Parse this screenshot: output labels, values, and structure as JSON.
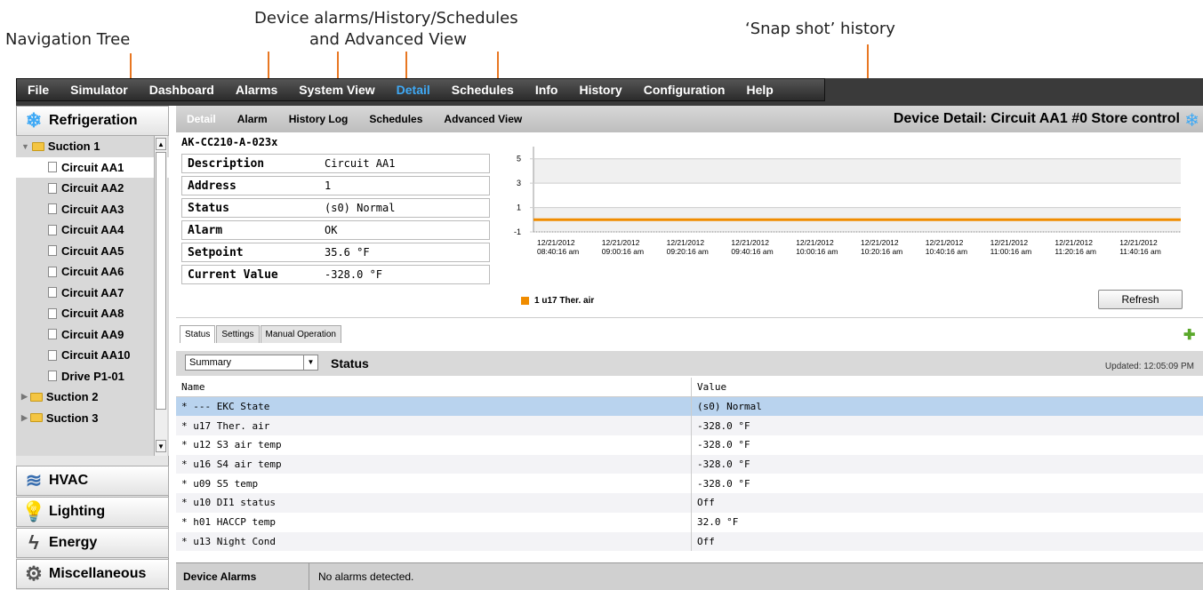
{
  "annotations": {
    "nav_tree": "Navigation Tree",
    "device_views_line1": "Device alarms/History/Schedules",
    "device_views_line2": "and Advanced View",
    "snapshot": "‘Snap shot’ history"
  },
  "menubar": {
    "items": [
      "File",
      "Simulator",
      "Dashboard",
      "Alarms",
      "System View",
      "Detail",
      "Schedules",
      "Info",
      "History",
      "Configuration",
      "Help"
    ],
    "active": "Detail"
  },
  "nav": {
    "categories": {
      "refrigeration": "Refrigeration",
      "hvac": "HVAC",
      "lighting": "Lighting",
      "energy": "Energy",
      "misc": "Miscellaneous"
    },
    "tree": [
      {
        "type": "folder",
        "label": "Suction 1",
        "open": true
      },
      {
        "type": "leaf",
        "label": "Circuit AA1",
        "selected": true
      },
      {
        "type": "leaf",
        "label": "Circuit AA2"
      },
      {
        "type": "leaf",
        "label": "Circuit AA3"
      },
      {
        "type": "leaf",
        "label": "Circuit AA4"
      },
      {
        "type": "leaf",
        "label": "Circuit AA5"
      },
      {
        "type": "leaf",
        "label": "Circuit AA6"
      },
      {
        "type": "leaf",
        "label": "Circuit AA7"
      },
      {
        "type": "leaf",
        "label": "Circuit AA8"
      },
      {
        "type": "leaf",
        "label": "Circuit AA9"
      },
      {
        "type": "leaf",
        "label": "Circuit AA10"
      },
      {
        "type": "leaf",
        "label": "Drive P1-01"
      },
      {
        "type": "folder",
        "label": "Suction 2",
        "open": false
      },
      {
        "type": "folder",
        "label": "Suction 3",
        "open": false
      }
    ]
  },
  "detail": {
    "tabs": [
      "Detail",
      "Alarm",
      "History Log",
      "Schedules",
      "Advanced View"
    ],
    "active_tab": "Detail",
    "title": "Device Detail: Circuit AA1  #0 Store control",
    "model": "AK-CC210-A-023x",
    "properties": [
      {
        "key": "Description",
        "value": "Circuit AA1"
      },
      {
        "key": "Address",
        "value": "1"
      },
      {
        "key": "Status",
        "value": "(s0) Normal"
      },
      {
        "key": "Alarm",
        "value": "OK"
      },
      {
        "key": "Setpoint",
        "value": "35.6 °F"
      },
      {
        "key": "Current Value",
        "value": "-328.0 °F"
      }
    ],
    "refresh_label": "Refresh",
    "legend": "1 u17 Ther. air"
  },
  "chart_data": {
    "type": "line",
    "yticks": [
      5,
      3,
      1,
      -1
    ],
    "ylim": [
      -1,
      6
    ],
    "x": [
      "12/21/2012 08:40:16 am",
      "12/21/2012 09:00:16 am",
      "12/21/2012 09:20:16 am",
      "12/21/2012 09:40:16 am",
      "12/21/2012 10:00:16 am",
      "12/21/2012 10:20:16 am",
      "12/21/2012 10:40:16 am",
      "12/21/2012 11:00:16 am",
      "12/21/2012 11:20:16 am",
      "12/21/2012 11:40:16 am"
    ],
    "series": [
      {
        "name": "1 u17 Ther. air",
        "values": [
          0,
          0,
          0,
          0,
          0,
          0,
          0,
          0,
          0,
          0,
          0
        ],
        "color": "#f08c00"
      }
    ],
    "grid": true,
    "legend": "bottom-left"
  },
  "status_panel": {
    "subtabs": [
      "Status",
      "Settings",
      "Manual Operation"
    ],
    "active_subtab": "Status",
    "view_select": "Summary",
    "label": "Status",
    "updated": "Updated: 12:05:09 PM",
    "columns": [
      "Name",
      "Value"
    ],
    "rows": [
      {
        "name": "* --- EKC State",
        "value": "(s0) Normal"
      },
      {
        "name": "* u17 Ther. air",
        "value": "-328.0 °F"
      },
      {
        "name": "* u12 S3 air temp",
        "value": "-328.0 °F"
      },
      {
        "name": "* u16 S4 air temp",
        "value": "-328.0 °F"
      },
      {
        "name": "* u09 S5 temp",
        "value": "-328.0 °F"
      },
      {
        "name": "* u10 DI1 status",
        "value": "Off"
      },
      {
        "name": "* h01 HACCP temp",
        "value": "32.0 °F"
      },
      {
        "name": "* u13 Night Cond",
        "value": "Off"
      }
    ],
    "selected_row": 0
  },
  "alarms_bar": {
    "label": "Device Alarms",
    "value": "No alarms detected."
  }
}
